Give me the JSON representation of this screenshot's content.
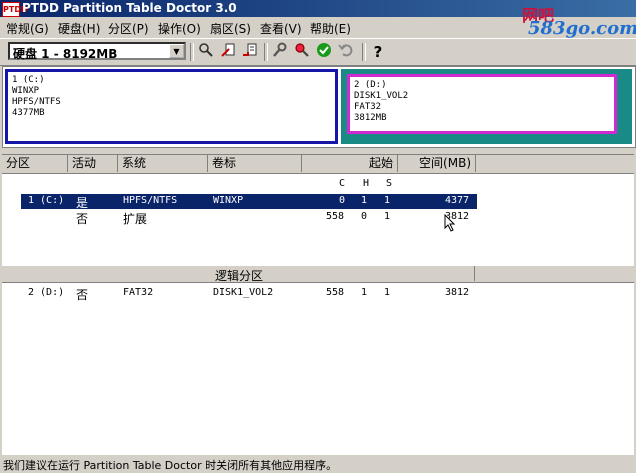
{
  "window": {
    "title": "PTDD Partition Table Doctor 3.0",
    "app_icon": "PTDD"
  },
  "watermark": {
    "line1": "网吧",
    "line2": "583go.com"
  },
  "menu": [
    "常规(G)",
    "硬盘(H)",
    "分区(P)",
    "操作(O)",
    "扇区(S)",
    "查看(V)",
    "帮助(E)"
  ],
  "toolbar": {
    "disk_select": "硬盘 1 - 8192MB",
    "icons": [
      "search-icon",
      "edit-icon",
      "backup-icon",
      "wrench-icon",
      "magnifier-icon",
      "check-icon",
      "undo-icon",
      "help-icon"
    ]
  },
  "partitions": [
    {
      "label": "1 (C:)",
      "name": "WINXP",
      "fs": "HPFS/NTFS",
      "size": "4377MB"
    },
    {
      "label": "2 (D:)",
      "name": "DISK1_VOL2",
      "fs": "FAT32",
      "size": "3812MB"
    }
  ],
  "colors": {
    "part1_border": "#1515a8",
    "part2_outer": "#1a8a86",
    "part2_border": "#d22ad2",
    "selection": "#0a246a"
  },
  "table": {
    "headers": [
      "分区",
      "活动",
      "系统",
      "卷标",
      "起始",
      "空间(MB)"
    ],
    "subheaders": [
      "C",
      "H",
      "S"
    ],
    "rows": [
      {
        "part": "1 (C:)",
        "active": "是",
        "system": "HPFS/NTFS",
        "label": "WINXP",
        "c": "0",
        "h": "1",
        "s": "1",
        "space": "4377"
      },
      {
        "part": "",
        "active": "否",
        "system": "扩展",
        "label": "",
        "c": "558",
        "h": "0",
        "s": "1",
        "space": "3812"
      }
    ],
    "logical_title": "逻辑分区",
    "logical_rows": [
      {
        "part": "2 (D:)",
        "active": "否",
        "system": "FAT32",
        "label": "DISK1_VOL2",
        "c": "558",
        "h": "1",
        "s": "1",
        "space": "3812"
      }
    ]
  },
  "status": "我们建议在运行 Partition Table Doctor 时关闭所有其他应用程序。"
}
